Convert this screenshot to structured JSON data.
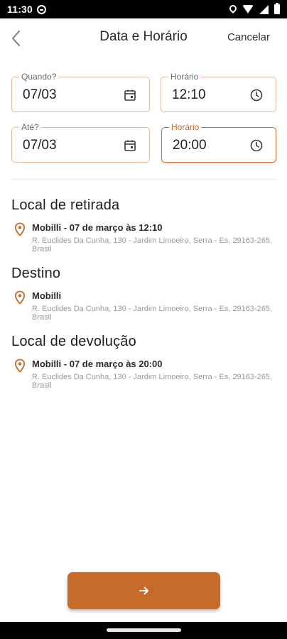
{
  "status_bar": {
    "time": "11:30"
  },
  "header": {
    "title": "Data e Horário",
    "cancel_label": "Cancelar"
  },
  "fields": {
    "quando": {
      "label": "Quando?",
      "value": "07/03"
    },
    "horario_inicio": {
      "label": "Horário",
      "value": "12:10"
    },
    "ate": {
      "label": "Até?",
      "value": "07/03"
    },
    "horario_fim": {
      "label": "Horário",
      "value": "20:00"
    }
  },
  "sections": [
    {
      "title": "Local de retirada",
      "name": "Mobilli - 07 de março às 12:10",
      "address": "R. Euclides Da Cunha, 130 - Jardim Limoeiro, Serra - Es, 29163-265, Brasil"
    },
    {
      "title": "Destino",
      "name": "Mobilli",
      "address": "R. Euclides Da Cunha, 130 - Jardim Limoeiro, Serra - Es, 29163-265, Brasil"
    },
    {
      "title": "Local de devolução",
      "name": "Mobilli - 07 de março às 20:00",
      "address": "R. Euclides Da Cunha, 130 - Jardim Limoeiro, Serra - Es, 29163-265, Brasil"
    }
  ],
  "icons": {
    "back": "chevron-left-icon",
    "calendar": "calendar-icon",
    "clock": "clock-icon",
    "pin": "map-pin-icon",
    "next": "arrow-right-icon"
  },
  "colors": {
    "accent": "#c76b2a",
    "field_border": "#e7b99a"
  }
}
